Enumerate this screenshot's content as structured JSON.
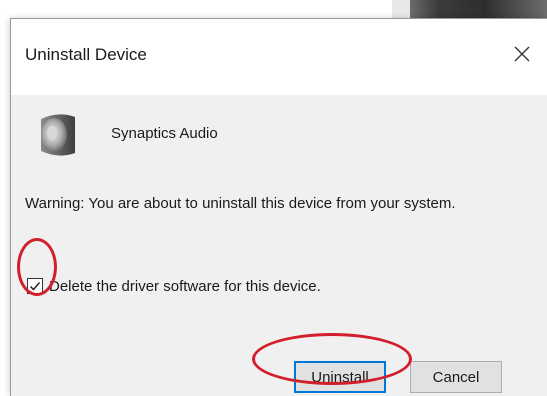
{
  "dialog": {
    "title": "Uninstall Device",
    "close_icon": "close-icon",
    "device": {
      "icon": "speaker-icon",
      "name": "Synaptics Audio"
    },
    "warning": "Warning: You are about to uninstall this device from your system.",
    "checkbox": {
      "label": "Delete the driver software for this device.",
      "checked": true
    },
    "buttons": {
      "uninstall": "Uninstall",
      "cancel": "Cancel"
    }
  },
  "colors": {
    "annotation": "#d21f2b",
    "content_bg": "#f0f0f0",
    "default_button_border": "#0078d7"
  }
}
